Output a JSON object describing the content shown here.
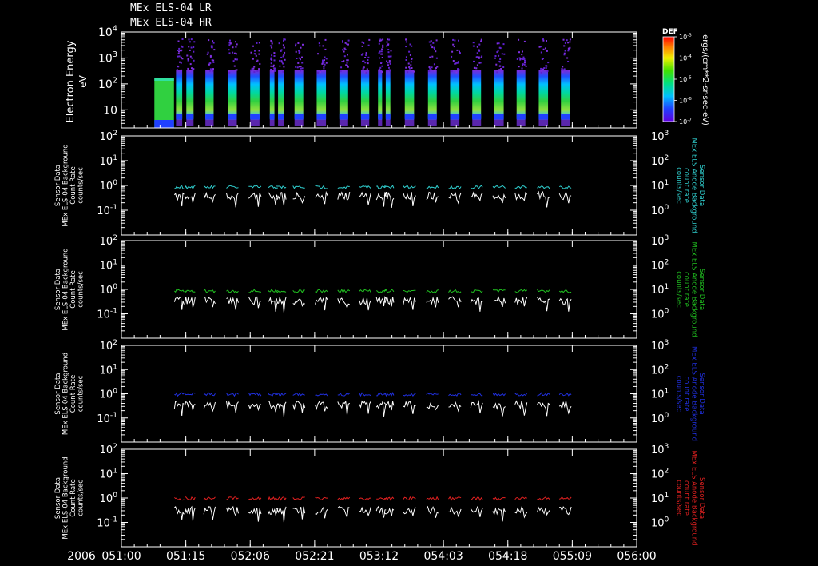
{
  "header": {
    "title_lines": [
      "MEx ELS-04 LR",
      "MEx ELS-04 HR"
    ]
  },
  "x_axis": {
    "year": "2006",
    "ticks": [
      "051:00",
      "051:15",
      "052:06",
      "052:21",
      "053:12",
      "054:03",
      "054:18",
      "055:09",
      "056:00"
    ]
  },
  "chart_data": [
    {
      "type": "heatmap",
      "ylabel": "Electron Energy",
      "yunit": "eV",
      "ylog": true,
      "yticks": [
        "10",
        "10^2",
        "10^3",
        "10^4"
      ],
      "colorbar": {
        "title": "DEF",
        "label": "ergs/(cm**2-sr-sec-eV)",
        "ticks": [
          "10^-7",
          "10^-6",
          "10^-5",
          "10^-4",
          "10^-3"
        ]
      },
      "data_columns": [
        {
          "x": 6.4,
          "w": 3.8,
          "kind": "flat"
        },
        {
          "x": 10.6,
          "w": 1.2
        },
        {
          "x": 12.6,
          "w": 1.4
        },
        {
          "x": 16.3,
          "w": 1.6
        },
        {
          "x": 20.7,
          "w": 1.7
        },
        {
          "x": 25.0,
          "w": 1.8
        },
        {
          "x": 28.8,
          "w": 0.9
        },
        {
          "x": 30.4,
          "w": 1.2
        },
        {
          "x": 33.6,
          "w": 1.7
        },
        {
          "x": 37.9,
          "w": 1.8
        },
        {
          "x": 42.3,
          "w": 1.7
        },
        {
          "x": 46.5,
          "w": 1.6
        },
        {
          "x": 49.8,
          "w": 0.8
        },
        {
          "x": 51.3,
          "w": 0.9
        },
        {
          "x": 55.0,
          "w": 1.8
        },
        {
          "x": 59.5,
          "w": 1.7
        },
        {
          "x": 63.8,
          "w": 1.8
        },
        {
          "x": 68.1,
          "w": 1.7
        },
        {
          "x": 72.4,
          "w": 1.8
        },
        {
          "x": 76.7,
          "w": 1.7
        },
        {
          "x": 81.0,
          "w": 1.8
        },
        {
          "x": 85.3,
          "w": 1.7
        }
      ]
    },
    {
      "type": "line",
      "ylabel_lines": [
        "Sensor Data",
        "MEx ELS-04 Background",
        "Count Rate",
        "counts/sec"
      ],
      "y2label_lines": [
        "Sensor Data",
        "MEx ELS Anode Background",
        "count rate",
        "counts/sec"
      ],
      "y2color": "#30d0d0",
      "ylog": true,
      "yticks": [
        "10^-1",
        "10^0",
        "10^1",
        "10^2"
      ],
      "y2ticks": [
        "10^0",
        "10^1",
        "10^2",
        "10^3"
      ],
      "series": [
        {
          "color": "#30d0d0",
          "axis": "right",
          "level": 0.85
        },
        {
          "color": "#ffffff",
          "axis": "left",
          "level": 0.55
        }
      ]
    },
    {
      "type": "line",
      "ylabel_lines": [
        "Sensor Data",
        "MEx ELS-04 Background",
        "Count Rate",
        "counts/sec"
      ],
      "y2label_lines": [
        "Sensor Data",
        "MEx ELS Anode Background",
        "count rate",
        "counts/sec"
      ],
      "y2color": "#20c020",
      "ylog": true,
      "yticks": [
        "10^-1",
        "10^0",
        "10^1",
        "10^2"
      ],
      "y2ticks": [
        "10^0",
        "10^1",
        "10^2",
        "10^3"
      ],
      "series": [
        {
          "color": "#20c020",
          "axis": "right",
          "level": 0.85
        },
        {
          "color": "#ffffff",
          "axis": "left",
          "level": 0.5
        }
      ]
    },
    {
      "type": "line",
      "ylabel_lines": [
        "Sensor Data",
        "MEx ELS-04 Background",
        "Count Rate",
        "counts/sec"
      ],
      "y2label_lines": [
        "Sensor Data",
        "MEx ELS Anode Background",
        "count rate",
        "counts/sec"
      ],
      "y2color": "#2030e0",
      "ylog": true,
      "yticks": [
        "10^-1",
        "10^0",
        "10^1",
        "10^2"
      ],
      "y2ticks": [
        "10^0",
        "10^1",
        "10^2",
        "10^3"
      ],
      "series": [
        {
          "color": "#2030e0",
          "axis": "right",
          "level": 0.95
        },
        {
          "color": "#ffffff",
          "axis": "left",
          "level": 0.5
        }
      ]
    },
    {
      "type": "line",
      "ylabel_lines": [
        "Sensor Data",
        "MEx ELS-04 Background",
        "Count Rate",
        "counts/sec"
      ],
      "y2label_lines": [
        "Sensor Data",
        "MEx ELS Anode Background",
        "count rate",
        "counts/sec"
      ],
      "y2color": "#e02020",
      "ylog": true,
      "yticks": [
        "10^-1",
        "10^0",
        "10^1",
        "10^2"
      ],
      "y2ticks": [
        "10^0",
        "10^1",
        "10^2",
        "10^3"
      ],
      "series": [
        {
          "color": "#e02020",
          "axis": "right",
          "level": 0.95
        },
        {
          "color": "#ffffff",
          "axis": "left",
          "level": 0.45
        }
      ]
    }
  ]
}
